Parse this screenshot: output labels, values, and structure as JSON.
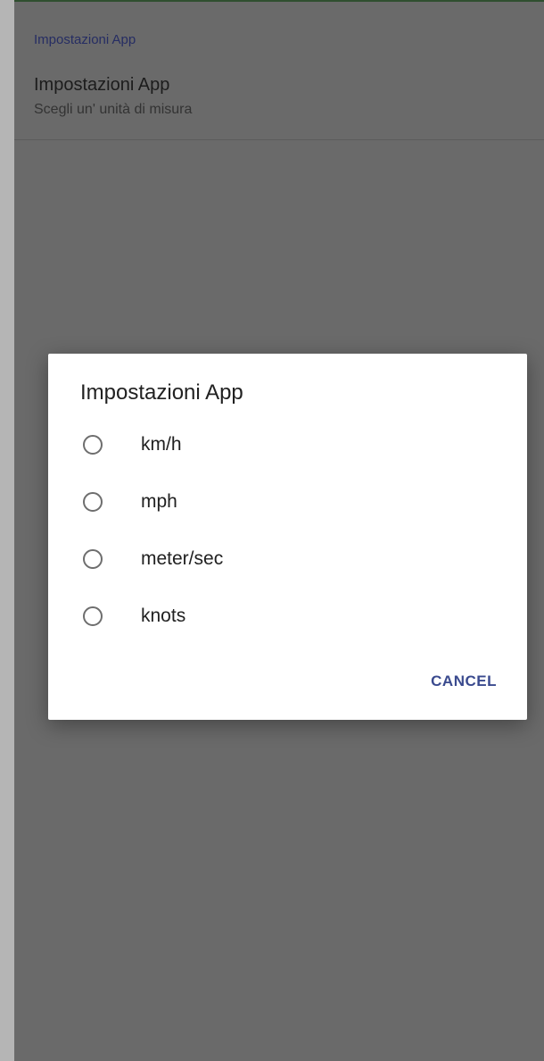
{
  "settings": {
    "category_header": "Impostazioni App",
    "preference_title": "Impostazioni App",
    "preference_summary": "Scegli un' unità di misura"
  },
  "dialog": {
    "title": "Impostazioni App",
    "options": [
      {
        "label": "km/h",
        "selected": false
      },
      {
        "label": "mph",
        "selected": false
      },
      {
        "label": "meter/sec",
        "selected": false
      },
      {
        "label": "knots",
        "selected": false
      }
    ],
    "cancel_label": "CANCEL"
  },
  "colors": {
    "scrim": "#6a6a6a",
    "accent": "#3a4a8e",
    "header_text": "#262d63",
    "dialog_bg": "#ffffff"
  }
}
